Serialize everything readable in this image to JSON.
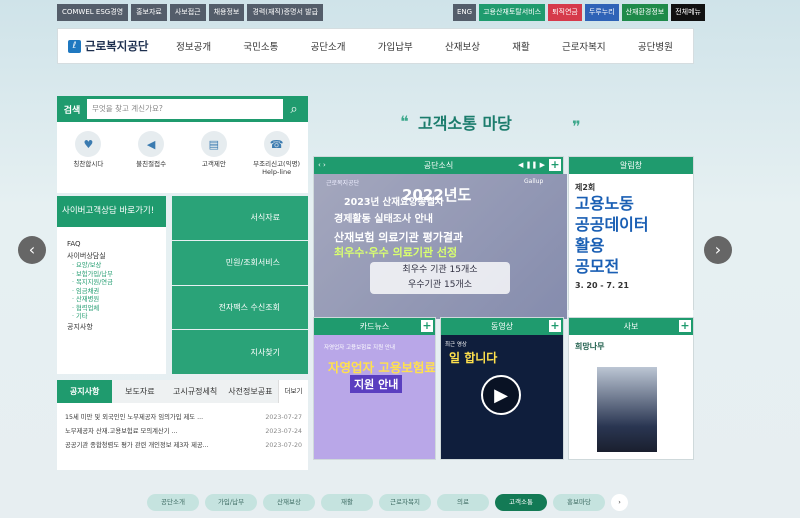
{
  "top_links": [
    "COMWEL ESG경영",
    "홍보자료",
    "사보접근",
    "채용정보",
    "경력(재직)증명서 발급"
  ],
  "top_right": [
    {
      "label": "ENG",
      "color": "#545d6a"
    },
    {
      "label": "고용산재토탈서비스",
      "color": "#1f9b6e"
    },
    {
      "label": "퇴직연금",
      "color": "#d63a4b"
    },
    {
      "label": "두루누리",
      "color": "#2f63b7"
    },
    {
      "label": "산재환경정보",
      "color": "#1f8a4a"
    },
    {
      "label": "전체메뉴",
      "color": "#111111"
    }
  ],
  "logo_text": "근로복지공단",
  "menu": [
    "정보공개",
    "국민소통",
    "공단소개",
    "가입납부",
    "산재보상",
    "재활",
    "근로자복지",
    "공단병원"
  ],
  "search": {
    "label": "검색",
    "placeholder": "무엇을 찾고 계신가요?"
  },
  "quick_icons": [
    {
      "label": "칭찬합시다",
      "icon": "heart-cup-icon"
    },
    {
      "label": "불친절접수",
      "icon": "megaphone-icon"
    },
    {
      "label": "고객제안",
      "icon": "document-icon"
    },
    {
      "label": "부조리신고(익명) Help-line",
      "icon": "headset-icon"
    }
  ],
  "cyber": {
    "title": "사이버고객상담 바로가기!",
    "items": [
      {
        "label": "FAQ",
        "sub": false
      },
      {
        "label": "사이버상담실",
        "sub": false
      },
      {
        "label": "· 요양/보상",
        "sub": true
      },
      {
        "label": "· 보험가입/납부",
        "sub": true
      },
      {
        "label": "· 복지지원/연금",
        "sub": true
      },
      {
        "label": "· 임금채권",
        "sub": true
      },
      {
        "label": "· 산재병원",
        "sub": true
      },
      {
        "label": "· 협력업체",
        "sub": true
      },
      {
        "label": "· 기타",
        "sub": true
      },
      {
        "label": "공지사항",
        "sub": false
      }
    ]
  },
  "services": [
    "서식자료",
    "민원/조회서비스",
    "전자팩스 수신조회",
    "지사찾기"
  ],
  "notice": {
    "tabs": [
      "공지사항",
      "보도자료",
      "고시규정세칙",
      "사전정보공표"
    ],
    "more": "더보기",
    "rows": [
      {
        "text": "15세 미만 및 외국인인 노무제공자 임의가입 제도 ...",
        "date": "2023-07-27"
      },
      {
        "text": "노무제공자 산재.고용보험료 모의계산기 ...",
        "date": "2023-07-24"
      },
      {
        "text": "공공기관 종합청렴도 평가 관련 개인정보 제3자 제공...",
        "date": "2023-07-20"
      }
    ]
  },
  "main_title": "고객소통 마당",
  "news": {
    "title": "공단소식",
    "l1": "2023년 산재요양종결자",
    "l2": "경제활동 실태조사 안내",
    "l3": "산재보험 의료기관 평가결과",
    "l4": "최우수·우수 의료기관 선정",
    "big": "2022년도",
    "box1": "최우수 기관 15개소",
    "box2": "우수기관 15개소",
    "badge": "Gallup",
    "small_logo": "근로복지공단"
  },
  "bulletin": {
    "title": "알림창",
    "p1": "제2회",
    "p2": "고용노동",
    "p3": "공공데이터",
    "p3b": "활용",
    "p3c": "공모전",
    "p4": "3. 20 - 7. 21"
  },
  "cardnews": {
    "title": "카드뉴스",
    "small": "자영업자 고용보험료 지원 안내",
    "h1": "자영업자 고용보험료",
    "h2": "지원 안내"
  },
  "video": {
    "title": "동영상",
    "cap": "최근 영상",
    "cap2": "일 합니다"
  },
  "magazine": {
    "title": "사보",
    "mt": "희망나무"
  },
  "bottom": [
    "공단소개",
    "가입/납부",
    "산재보상",
    "재활",
    "근로자복지",
    "의료",
    "고객소통",
    "홍보마당"
  ],
  "bottom_active": "고객소통",
  "arrows": {
    "left": "‹",
    "right": "›"
  }
}
